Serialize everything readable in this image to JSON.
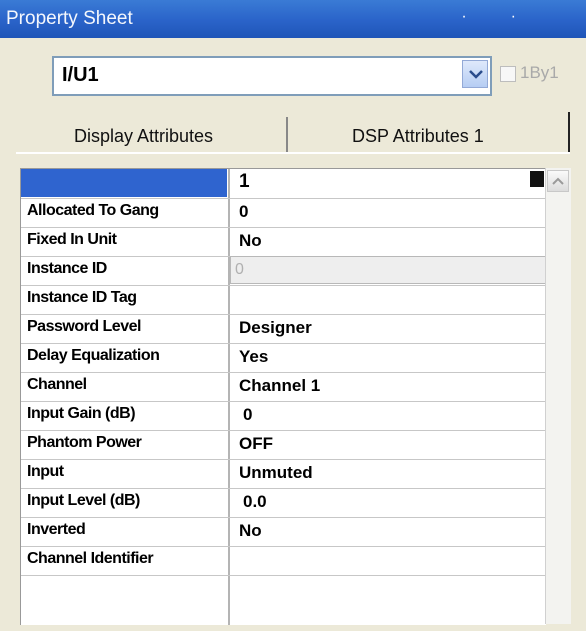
{
  "window": {
    "title": "Property Sheet"
  },
  "object_select": {
    "value": "I/U1"
  },
  "by1_checkbox": {
    "label": "1By1"
  },
  "tabs": [
    {
      "label": "Display Attributes"
    },
    {
      "label": "DSP Attributes 1"
    }
  ],
  "properties": [
    {
      "name": "",
      "value": "1"
    },
    {
      "name": "Allocated To Gang",
      "value": "0"
    },
    {
      "name": "Fixed In Unit",
      "value": "No"
    },
    {
      "name": "Instance ID",
      "value": "0"
    },
    {
      "name": "Instance ID Tag",
      "value": ""
    },
    {
      "name": "Password Level",
      "value": "Designer"
    },
    {
      "name": "Delay Equalization",
      "value": "Yes"
    },
    {
      "name": "Channel",
      "value": "Channel 1"
    },
    {
      "name": "Input Gain (dB)",
      "value": "0"
    },
    {
      "name": "Phantom Power",
      "value": "OFF"
    },
    {
      "name": "Input",
      "value": "Unmuted"
    },
    {
      "name": "Input Level (dB)",
      "value": "0.0"
    },
    {
      "name": "Inverted",
      "value": "No"
    },
    {
      "name": "Channel Identifier",
      "value": ""
    }
  ],
  "colors": {
    "title_bar": "#2a63c9",
    "selection": "#2f64cf",
    "background": "#ece9d8"
  }
}
